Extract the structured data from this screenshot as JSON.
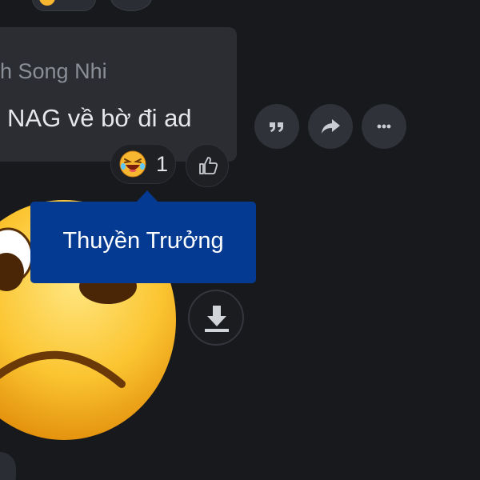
{
  "message": {
    "sender_name": "h Song Nhi",
    "text": "NAG về bờ đi ad"
  },
  "reactions": {
    "emoji_icon": "laughing-face-icon",
    "count": "1"
  },
  "tooltip": {
    "text": "Thuyền Trưởng"
  },
  "actions": {
    "quote_icon": "quote-icon",
    "share_icon": "share-arrow-icon",
    "more_icon": "more-dots-icon",
    "like_icon": "thumbs-up-icon",
    "download_icon": "download-icon"
  },
  "colors": {
    "background": "#18191c",
    "bubble": "#2b2d33",
    "tooltip": "#053a93",
    "emoji_yellow": "#f7b731"
  }
}
